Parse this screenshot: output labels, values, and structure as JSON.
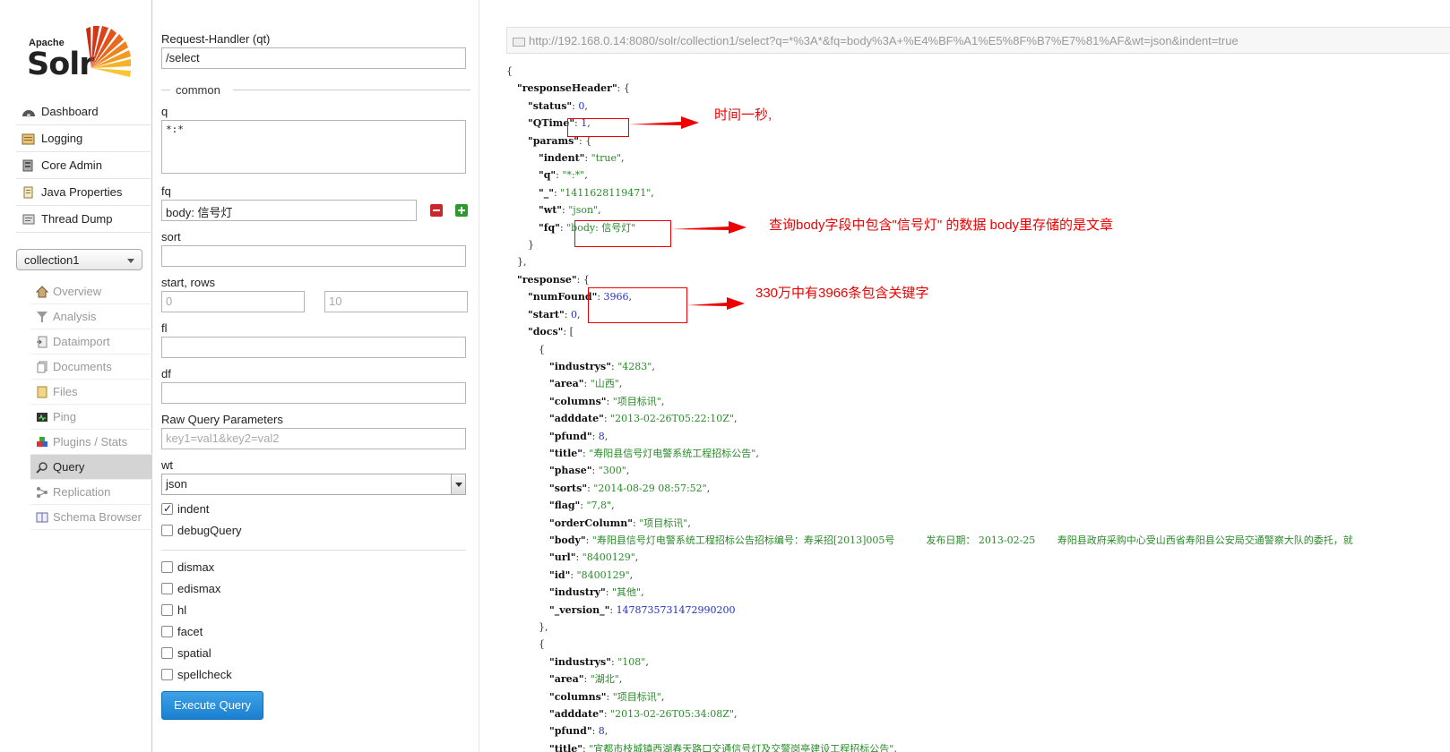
{
  "sidebar": {
    "logo_apache": "Apache",
    "logo_solr": "Solr",
    "main_nav": [
      {
        "label": "Dashboard",
        "icon": "dashboard-icon"
      },
      {
        "label": "Logging",
        "icon": "logging-icon"
      },
      {
        "label": "Core Admin",
        "icon": "core-admin-icon"
      },
      {
        "label": "Java Properties",
        "icon": "java-icon"
      },
      {
        "label": "Thread Dump",
        "icon": "thread-dump-icon"
      }
    ],
    "core_selector": "collection1",
    "core_nav": [
      {
        "label": "Overview",
        "icon": "home-icon",
        "active": false
      },
      {
        "label": "Analysis",
        "icon": "funnel-icon",
        "active": false
      },
      {
        "label": "Dataimport",
        "icon": "import-icon",
        "active": false
      },
      {
        "label": "Documents",
        "icon": "documents-icon",
        "active": false
      },
      {
        "label": "Files",
        "icon": "files-icon",
        "active": false
      },
      {
        "label": "Ping",
        "icon": "ping-icon",
        "active": false
      },
      {
        "label": "Plugins / Stats",
        "icon": "plugins-icon",
        "active": false
      },
      {
        "label": "Query",
        "icon": "query-icon",
        "active": true
      },
      {
        "label": "Replication",
        "icon": "replication-icon",
        "active": false
      },
      {
        "label": "Schema Browser",
        "icon": "schema-icon",
        "active": false
      }
    ]
  },
  "form": {
    "handler_label": "Request-Handler (qt)",
    "handler_value": "/select",
    "common_legend": "common",
    "q_label": "q",
    "q_value": "*:*",
    "fq_label": "fq",
    "fq_value": "body: 信号灯",
    "sort_label": "sort",
    "sort_value": "",
    "start_rows_label": "start, rows",
    "start_placeholder": "0",
    "rows_placeholder": "10",
    "fl_label": "fl",
    "df_label": "df",
    "raw_label": "Raw Query Parameters",
    "raw_placeholder": "key1=val1&key2=val2",
    "wt_label": "wt",
    "wt_value": "json",
    "indent_label": "indent",
    "debug_label": "debugQuery",
    "dismax_label": "dismax",
    "edismax_label": "edismax",
    "hl_label": "hl",
    "facet_label": "facet",
    "spatial_label": "spatial",
    "spellcheck_label": "spellcheck",
    "execute_label": "Execute Query"
  },
  "result": {
    "url": "http://192.168.0.14:8080/solr/collection1/select?q=*%3A*&fq=body%3A+%E4%BF%A1%E5%8F%B7%E7%81%AF&wt=json&indent=true"
  },
  "annotations": {
    "qtime": "时间一秒,",
    "fq": "查询body字段中包含\"信号灯\" 的数据 body里存储的是文章",
    "numfound": "330万中有3966条包含关键字"
  },
  "colors": {
    "annotation_red": "#e00000",
    "execute_blue": "#1a7fd0",
    "json_string_green": "#2a8a2a",
    "json_number_blue": "#2231c5"
  },
  "json_lines": [
    {
      "i": 0,
      "parts": [
        [
          "p",
          "{"
        ]
      ]
    },
    {
      "i": 1,
      "parts": [
        [
          "k",
          "\"responseHeader\""
        ],
        [
          "p",
          ": {"
        ]
      ]
    },
    {
      "i": 2,
      "parts": [
        [
          "k",
          "\"status\""
        ],
        [
          "p",
          ": "
        ],
        [
          "n",
          "0"
        ],
        [
          "p",
          ","
        ]
      ]
    },
    {
      "i": 2,
      "parts": [
        [
          "k",
          "\"QTime\""
        ],
        [
          "p",
          ": "
        ],
        [
          "n",
          "1"
        ],
        [
          "p",
          ","
        ]
      ]
    },
    {
      "i": 2,
      "parts": [
        [
          "k",
          "\"params\""
        ],
        [
          "p",
          ": {"
        ]
      ]
    },
    {
      "i": 3,
      "parts": [
        [
          "k",
          "\"indent\""
        ],
        [
          "p",
          ": "
        ],
        [
          "s",
          "\"true\""
        ],
        [
          "p",
          ","
        ]
      ]
    },
    {
      "i": 3,
      "parts": [
        [
          "k",
          "\"q\""
        ],
        [
          "p",
          ": "
        ],
        [
          "s",
          "\"*:*\""
        ],
        [
          "p",
          ","
        ]
      ]
    },
    {
      "i": 3,
      "parts": [
        [
          "k",
          "\"_\""
        ],
        [
          "p",
          ": "
        ],
        [
          "s",
          "\"1411628119471\""
        ],
        [
          "p",
          ","
        ]
      ]
    },
    {
      "i": 3,
      "parts": [
        [
          "k",
          "\"wt\""
        ],
        [
          "p",
          ": "
        ],
        [
          "s",
          "\"json\""
        ],
        [
          "p",
          ","
        ]
      ]
    },
    {
      "i": 3,
      "parts": [
        [
          "k",
          "\"fq\""
        ],
        [
          "p",
          ": "
        ],
        [
          "s",
          "\"body: 信号灯\""
        ]
      ]
    },
    {
      "i": 2,
      "parts": [
        [
          "p",
          "}"
        ]
      ]
    },
    {
      "i": 1,
      "parts": [
        [
          "p",
          "},"
        ]
      ]
    },
    {
      "i": 1,
      "parts": [
        [
          "k",
          "\"response\""
        ],
        [
          "p",
          ": {"
        ]
      ]
    },
    {
      "i": 2,
      "parts": [
        [
          "k",
          "\"numFound\""
        ],
        [
          "p",
          ": "
        ],
        [
          "n",
          "3966"
        ],
        [
          "p",
          ","
        ]
      ]
    },
    {
      "i": 2,
      "parts": [
        [
          "k",
          "\"start\""
        ],
        [
          "p",
          ": "
        ],
        [
          "n",
          "0"
        ],
        [
          "p",
          ","
        ]
      ]
    },
    {
      "i": 2,
      "parts": [
        [
          "k",
          "\"docs\""
        ],
        [
          "p",
          ": ["
        ]
      ]
    },
    {
      "i": 3,
      "parts": [
        [
          "p",
          "{"
        ]
      ]
    },
    {
      "i": 4,
      "parts": [
        [
          "k",
          "\"industrys\""
        ],
        [
          "p",
          ": "
        ],
        [
          "s",
          "\"4283\""
        ],
        [
          "p",
          ","
        ]
      ]
    },
    {
      "i": 4,
      "parts": [
        [
          "k",
          "\"area\""
        ],
        [
          "p",
          ": "
        ],
        [
          "s",
          "\"山西\""
        ],
        [
          "p",
          ","
        ]
      ]
    },
    {
      "i": 4,
      "parts": [
        [
          "k",
          "\"columns\""
        ],
        [
          "p",
          ": "
        ],
        [
          "s",
          "\"项目标讯\""
        ],
        [
          "p",
          ","
        ]
      ]
    },
    {
      "i": 4,
      "parts": [
        [
          "k",
          "\"adddate\""
        ],
        [
          "p",
          ": "
        ],
        [
          "s",
          "\"2013-02-26T05:22:10Z\""
        ],
        [
          "p",
          ","
        ]
      ]
    },
    {
      "i": 4,
      "parts": [
        [
          "k",
          "\"pfund\""
        ],
        [
          "p",
          ": "
        ],
        [
          "n",
          "8"
        ],
        [
          "p",
          ","
        ]
      ]
    },
    {
      "i": 4,
      "parts": [
        [
          "k",
          "\"title\""
        ],
        [
          "p",
          ": "
        ],
        [
          "s",
          "\"寿阳县信号灯电警系统工程招标公告\""
        ],
        [
          "p",
          ","
        ]
      ]
    },
    {
      "i": 4,
      "parts": [
        [
          "k",
          "\"phase\""
        ],
        [
          "p",
          ": "
        ],
        [
          "s",
          "\"300\""
        ],
        [
          "p",
          ","
        ]
      ]
    },
    {
      "i": 4,
      "parts": [
        [
          "k",
          "\"sorts\""
        ],
        [
          "p",
          ": "
        ],
        [
          "s",
          "\"2014-08-29 08:57:52\""
        ],
        [
          "p",
          ","
        ]
      ]
    },
    {
      "i": 4,
      "parts": [
        [
          "k",
          "\"flag\""
        ],
        [
          "p",
          ": "
        ],
        [
          "s",
          "\"7,8\""
        ],
        [
          "p",
          ","
        ]
      ]
    },
    {
      "i": 4,
      "parts": [
        [
          "k",
          "\"orderColumn\""
        ],
        [
          "p",
          ": "
        ],
        [
          "s",
          "\"项目标讯\""
        ],
        [
          "p",
          ","
        ]
      ]
    },
    {
      "i": 4,
      "parts": [
        [
          "k",
          "\"body\""
        ],
        [
          "p",
          ": "
        ],
        [
          "s",
          "\"寿阳县信号灯电警系统工程招标公告招标编号：寿采招[2013]005号          发布日期： 2013-02-25       寿阳县政府采购中心受山西省寿阳县公安局交通警察大队的委托，就"
        ]
      ]
    },
    {
      "i": 4,
      "parts": [
        [
          "k",
          "\"url\""
        ],
        [
          "p",
          ": "
        ],
        [
          "s",
          "\"8400129\""
        ],
        [
          "p",
          ","
        ]
      ]
    },
    {
      "i": 4,
      "parts": [
        [
          "k",
          "\"id\""
        ],
        [
          "p",
          ": "
        ],
        [
          "s",
          "\"8400129\""
        ],
        [
          "p",
          ","
        ]
      ]
    },
    {
      "i": 4,
      "parts": [
        [
          "k",
          "\"industry\""
        ],
        [
          "p",
          ": "
        ],
        [
          "s",
          "\"其他\""
        ],
        [
          "p",
          ","
        ]
      ]
    },
    {
      "i": 4,
      "parts": [
        [
          "k",
          "\"_version_\""
        ],
        [
          "p",
          ": "
        ],
        [
          "n",
          "1478735731472990200"
        ]
      ]
    },
    {
      "i": 3,
      "parts": [
        [
          "p",
          "},"
        ]
      ]
    },
    {
      "i": 3,
      "parts": [
        [
          "p",
          "{"
        ]
      ]
    },
    {
      "i": 4,
      "parts": [
        [
          "k",
          "\"industrys\""
        ],
        [
          "p",
          ": "
        ],
        [
          "s",
          "\"108\""
        ],
        [
          "p",
          ","
        ]
      ]
    },
    {
      "i": 4,
      "parts": [
        [
          "k",
          "\"area\""
        ],
        [
          "p",
          ": "
        ],
        [
          "s",
          "\"湖北\""
        ],
        [
          "p",
          ","
        ]
      ]
    },
    {
      "i": 4,
      "parts": [
        [
          "k",
          "\"columns\""
        ],
        [
          "p",
          ": "
        ],
        [
          "s",
          "\"项目标讯\""
        ],
        [
          "p",
          ","
        ]
      ]
    },
    {
      "i": 4,
      "parts": [
        [
          "k",
          "\"adddate\""
        ],
        [
          "p",
          ": "
        ],
        [
          "s",
          "\"2013-02-26T05:34:08Z\""
        ],
        [
          "p",
          ","
        ]
      ]
    },
    {
      "i": 4,
      "parts": [
        [
          "k",
          "\"pfund\""
        ],
        [
          "p",
          ": "
        ],
        [
          "n",
          "8"
        ],
        [
          "p",
          ","
        ]
      ]
    },
    {
      "i": 4,
      "parts": [
        [
          "k",
          "\"title\""
        ],
        [
          "p",
          ": "
        ],
        [
          "s",
          "\"宜都市枝城镇西湖春天路口交通信号灯及交警岗亭建设工程招标公告\""
        ],
        [
          "p",
          ","
        ]
      ]
    }
  ]
}
